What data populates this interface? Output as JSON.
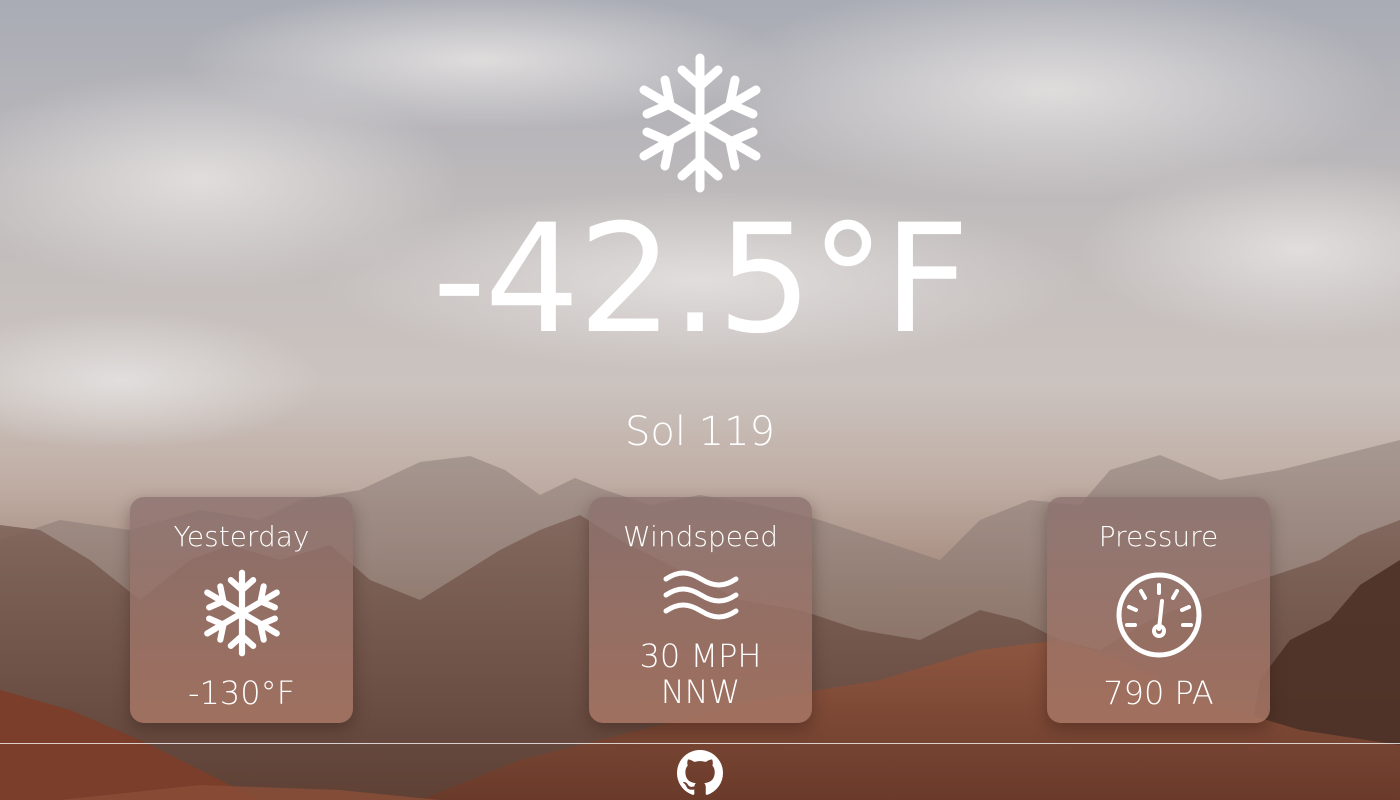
{
  "current": {
    "temperature": "-42.5°F",
    "sol": "Sol 119",
    "icon": "snowflake-icon"
  },
  "cards": {
    "yesterday": {
      "title": "Yesterday",
      "icon": "snowflake-icon",
      "value": "-130°F"
    },
    "windspeed": {
      "title": "Windspeed",
      "icon": "wind-icon",
      "speed": "30 MPH",
      "direction": "NNW"
    },
    "pressure": {
      "title": "Pressure",
      "icon": "gauge-icon",
      "value": "790 PA"
    }
  },
  "footer": {
    "icon": "github-icon"
  },
  "colors": {
    "text": "#ffffff",
    "card": "#a37868"
  }
}
